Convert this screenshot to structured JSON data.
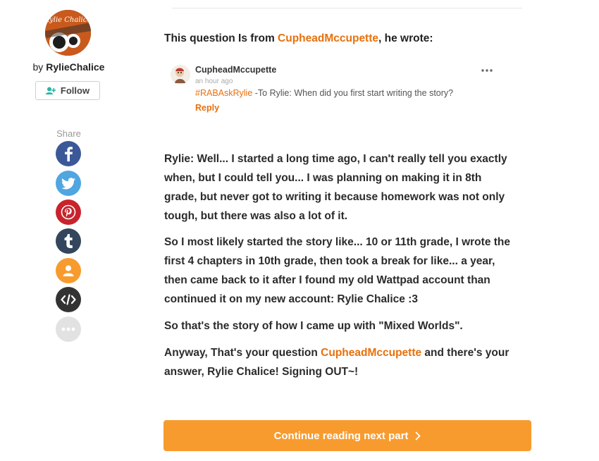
{
  "author": {
    "by_prefix": "by",
    "name": "RylieChalice",
    "avatar_text": "Rylie Chalice",
    "follow_label": "Follow"
  },
  "share": {
    "label": "Share",
    "buttons": [
      {
        "name": "facebook",
        "icon": "facebook-icon",
        "color": "#3b5998"
      },
      {
        "name": "twitter",
        "icon": "twitter-icon",
        "color": "#4fa6e1"
      },
      {
        "name": "pinterest",
        "icon": "pinterest-icon",
        "color": "#c8232c"
      },
      {
        "name": "tumblr",
        "icon": "tumblr-icon",
        "color": "#34465d"
      },
      {
        "name": "profile",
        "icon": "person-icon",
        "color": "#f89b2e"
      },
      {
        "name": "embed",
        "icon": "code-icon",
        "color": "#333333"
      },
      {
        "name": "more",
        "icon": "more-icon",
        "color": "#e2e2e2"
      }
    ]
  },
  "intro": {
    "prefix": "This question Is from ",
    "user": "CupheadMccupette",
    "suffix": ", he wrote:"
  },
  "comment": {
    "username": "CupheadMccupette",
    "time": "an hour ago",
    "hashtag": "#RABAskRylie",
    "text": " -To Rylie: When did you first start writing the story?",
    "reply_label": "Reply"
  },
  "story": {
    "p1": "Rylie: Well... I started a long time ago, I can't really tell you exactly when, but I could tell you... I was planning on making it in 8th grade, but never got to writing it because homework was not only tough, but there was also a lot of it.",
    "p2": "So I most likely started the story like... 10 or 11th grade, I wrote the first 4 chapters in 10th grade, then took a break for like... a year, then came back to it after I found my old Wattpad account than continued it on my new account: Rylie Chalice :3",
    "p3": "So that's the story of how I came up with \"Mixed Worlds\".",
    "p4_prefix": "Anyway, That's your question ",
    "p4_user": "CupheadMccupette",
    "p4_suffix": " and there's your answer, Rylie Chalice! Signing OUT~!"
  },
  "continue_label": "Continue reading next part",
  "colors": {
    "accent": "#e8700b",
    "button": "#f89b2e"
  }
}
